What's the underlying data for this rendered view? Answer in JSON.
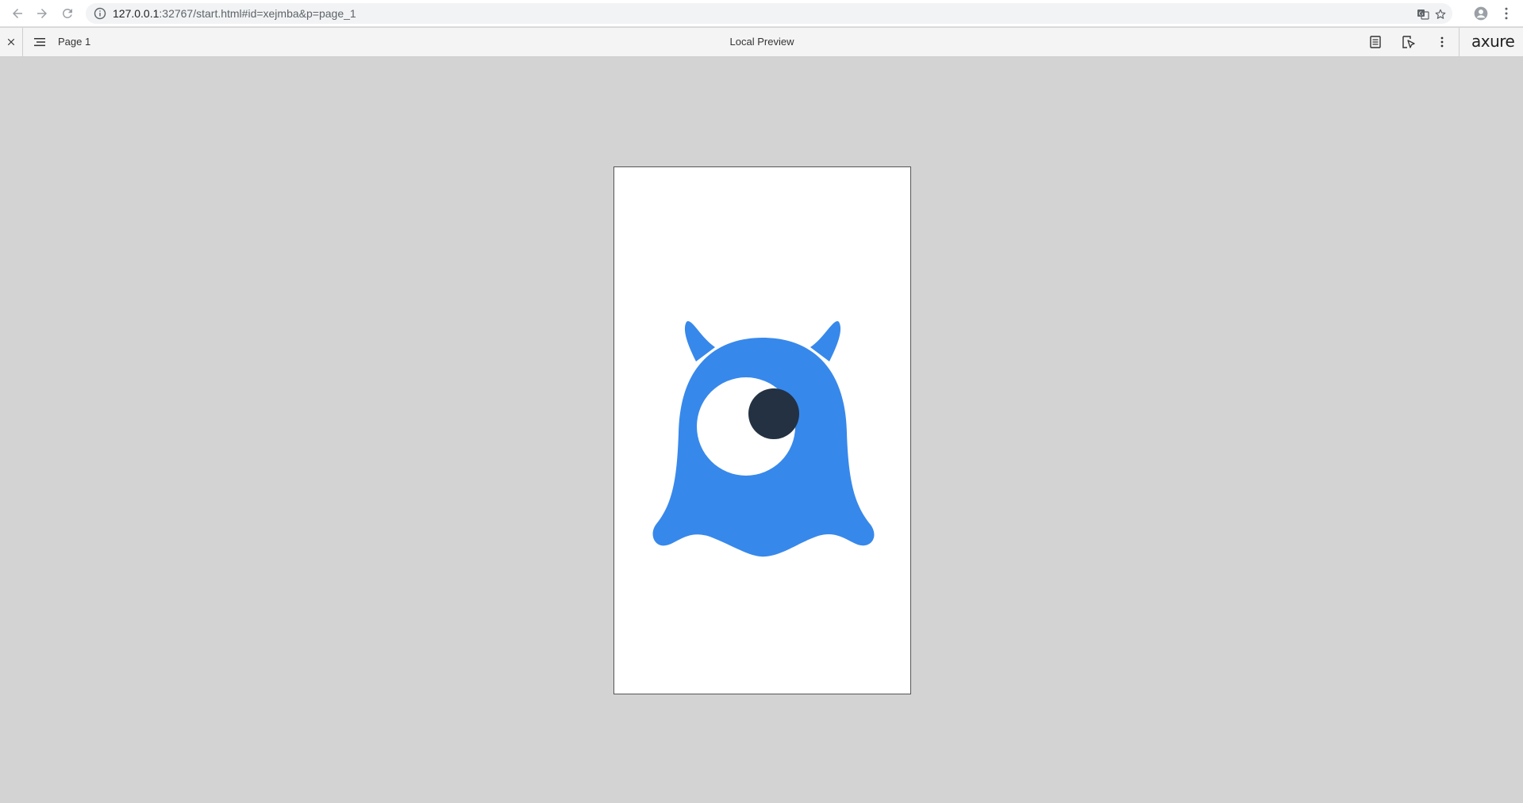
{
  "browser": {
    "url_host": "127.0.0.1",
    "url_path": ":32767/start.html#id=xejmba&p=page_1",
    "icons": {
      "back": "back-arrow-icon",
      "forward": "forward-arrow-icon",
      "reload": "reload-icon",
      "site_info": "info-icon",
      "translate": "translate-icon",
      "bookmark": "star-icon",
      "profile": "profile-icon",
      "menu": "kebab-menu-icon"
    }
  },
  "toolbar": {
    "page_name": "Page 1",
    "title": "Local Preview",
    "logo_text": "axure",
    "icons": {
      "close": "close-icon",
      "sitemap": "hamburger-icon",
      "notes": "notes-icon",
      "inspect": "inspect-icon",
      "more": "more-icon"
    }
  },
  "canvas": {
    "background_color": "#d3d3d3",
    "artboard_color": "#ffffff",
    "monster_color": "#3788eb",
    "pupil_color": "#243142",
    "eye_color": "#ffffff"
  }
}
